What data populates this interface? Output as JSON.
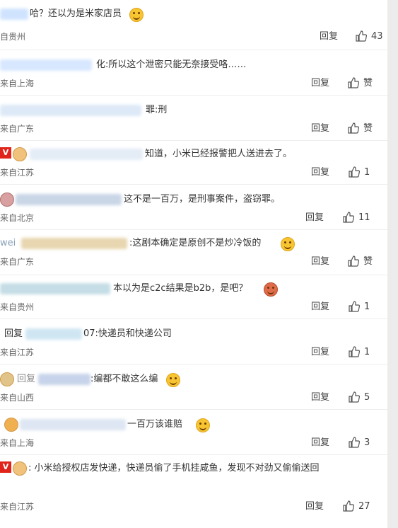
{
  "labels": {
    "reply": "回复",
    "like_zero": "赞"
  },
  "comments": [
    {
      "prefix": "",
      "text": "哈？还以为是米家店员",
      "location": "自贵州",
      "likes": "43"
    },
    {
      "prefix": "",
      "text": "化:所以这个泄密只能无奈接受咯……",
      "location": "来自上海",
      "likes": "赞"
    },
    {
      "prefix": "",
      "text": "罪:刑",
      "location": "来自广东",
      "likes": "赞"
    },
    {
      "prefix": "V",
      "text": "知道，小米已经报警把人送进去了。",
      "location": "来自江苏",
      "likes": "1"
    },
    {
      "prefix": "",
      "text": "这不是一百万，是刑事案件，盗窃罪。",
      "location": "来自北京",
      "likes": "11"
    },
    {
      "prefix": "wei",
      "text": ":这剧本确定是原创不是炒冷饭的",
      "location": "来自广东",
      "likes": "赞"
    },
    {
      "prefix": "",
      "text": "本以为是c2c结果是b2b，是吧？",
      "location": "来自贵州",
      "likes": "1"
    },
    {
      "prefix": "回复",
      "text": "07:快递员和快递公司",
      "location": "来自江苏",
      "likes": "1"
    },
    {
      "prefix": "回复",
      "text": ":编都不敢这么编",
      "location": "来自山西",
      "likes": "5"
    },
    {
      "prefix": "",
      "text": "一百万该谁赔",
      "location": "来自上海",
      "likes": "3"
    },
    {
      "prefix": "V",
      "text": ": 小米给授权店发快递，快递员偷了手机挂咸鱼，发现不对劲又偷偷送回",
      "location": "来自江苏",
      "likes": "27"
    }
  ],
  "colors": {
    "accent": "#e0241b",
    "text": "#333333",
    "divider": "#eeeeee"
  },
  "icons": {
    "like": "thumbs-up-icon",
    "emoji": "smiley-emoji-icon",
    "verified": "v-badge-icon"
  }
}
